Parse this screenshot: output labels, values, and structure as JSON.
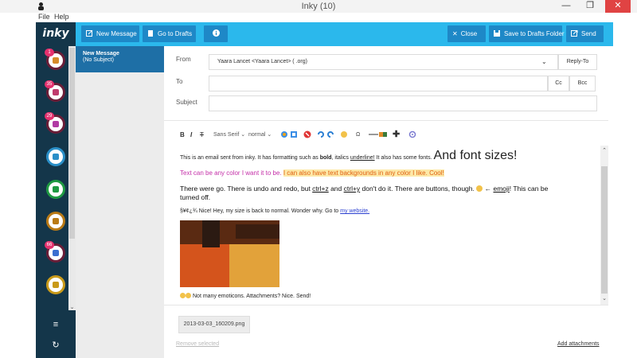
{
  "window": {
    "title": "Inky (10)",
    "minimize": "—",
    "maximize": "❐",
    "close": "✕"
  },
  "menu": {
    "file": "File",
    "help": "Help"
  },
  "app": {
    "logo": "inky"
  },
  "toolbar": {
    "new_message": "New Message",
    "go_to_drafts": "Go to Drafts",
    "info": "i",
    "close": "Close",
    "save_to_drafts": "Save to Drafts Folder",
    "send": "Send"
  },
  "accounts": [
    {
      "badge": "1",
      "color": "#6a1e38",
      "inner": "#d68b2a"
    },
    {
      "badge": "35",
      "color": "#6a1e38",
      "inner": "#bf3b6c"
    },
    {
      "badge": "29",
      "color": "#6a1e38",
      "inner": "#b13aa3"
    },
    {
      "badge": "",
      "color": "#2a8fc8",
      "inner": "#2a8fc8"
    },
    {
      "badge": "",
      "color": "#1f9a42",
      "inner": "#1f9a42"
    },
    {
      "badge": "",
      "color": "#b97a16",
      "inner": "#b97a16"
    },
    {
      "badge": "66",
      "color": "#6a1e38",
      "inner": "#3a6fd0"
    },
    {
      "badge": "",
      "color": "#c99a1a",
      "inner": "#c99a1a"
    }
  ],
  "rail": {
    "menu_icon": "≡",
    "refresh_icon": "↻"
  },
  "message_list": {
    "item_title": "New Message",
    "item_subtitle": "(No Subject)"
  },
  "compose": {
    "from_label": "From",
    "from_value": "Yaara Lancet <Yaara Lancet> (         .org)",
    "reply_to": "Reply-To",
    "to_label": "To",
    "to_value": "",
    "cc": "Cc",
    "bcc": "Bcc",
    "subject_label": "Subject",
    "subject_value": ""
  },
  "format_toolbar": {
    "bold": "B",
    "italic": "I",
    "strike": "T",
    "font": "Sans Serif",
    "size": "normal"
  },
  "body": {
    "line1_a": "This is an email sent from inky. It has formatting such as ",
    "line1_bold": "bold",
    "line1_b": ", italics ",
    "line1_underline": "underline!",
    "line1_c": " It also has some fonts. ",
    "line1_big": "And font sizes!",
    "line2_a": "Text can be any color I want it to be. ",
    "line2_b": "I can also have text backgrounds in any color I like. Cool!",
    "line3_a": "There were go. There is undo and redo, but ",
    "line3_ctrlz": "ctrl+z",
    "line3_b": " and ",
    "line3_ctrly": "ctrl+y",
    "line3_c": " don't do it. There are buttons, though. ",
    "line3_d": " ← ",
    "line3_emoji": "emoji",
    "line3_e": "! This can be",
    "line3_f": "turned off.",
    "line4_a": "§¥¢¿¾ Nice! Hey, my size is back to normal. Wonder why. Go to ",
    "line4_link": "my website.",
    "line5": "Not many emoticons. Attachments? Nice. Send!"
  },
  "attachments": {
    "file": "2013-03-03_160209.png",
    "remove_selected": "Remove selected",
    "add_attachments": "Add attachments"
  },
  "colors": {
    "toolbar": "#2bb8ec",
    "toolbar_button": "#1e88c7",
    "rail": "#14364a",
    "selected_item": "#1e6fa6",
    "magenta_text": "#c42fa8",
    "highlight_bg": "#fde9a8",
    "highlight_text": "#e06010"
  }
}
